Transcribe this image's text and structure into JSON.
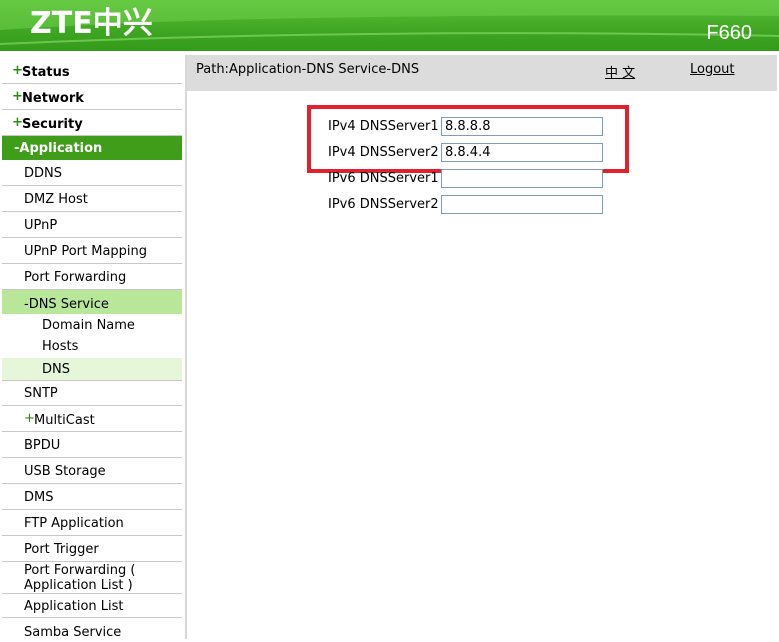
{
  "header": {
    "logo_text": "ZTE中兴",
    "model": "F660",
    "brand_color": "#3fa623"
  },
  "sidebar": {
    "top_sections": [
      {
        "label": "Status",
        "prefix": "+"
      },
      {
        "label": "Network",
        "prefix": "+"
      },
      {
        "label": "Security",
        "prefix": "+"
      },
      {
        "label": "-Application",
        "prefix": ""
      }
    ],
    "app_items": [
      "DDNS",
      "DMZ Host",
      "UPnP",
      "UPnP Port Mapping",
      "Port Forwarding"
    ],
    "dns_service": "-DNS Service",
    "dns_sub_items": [
      "Domain Name",
      "Hosts",
      "DNS"
    ],
    "more_items": [
      "SNTP"
    ],
    "multicast": {
      "prefix": "+",
      "label": "MultiCast"
    },
    "tail_items": [
      "BPDU",
      "USB Storage",
      "DMS",
      "FTP Application",
      "Port Trigger"
    ],
    "port_forwarding_app_list": [
      "Port Forwarding (",
      "Application List )"
    ],
    "last_items": [
      "Application List",
      "Samba Service"
    ],
    "active_section_color": "#3f9d19",
    "active_sub_color": "#b8e79a",
    "active_leaf_color": "#e5f6d9"
  },
  "main": {
    "path": "Path:Application-DNS Service-DNS",
    "lang_link": "中 文",
    "logout": "Logout",
    "fields": [
      {
        "label": "IPv4 DNSServer1",
        "value": "8.8.8.8"
      },
      {
        "label": "IPv4 DNSServer2",
        "value": "8.8.4.4"
      },
      {
        "label": "IPv6 DNSServer1",
        "value": ""
      },
      {
        "label": "IPv6 DNSServer2",
        "value": ""
      }
    ],
    "highlight_color": "#e3212e"
  }
}
